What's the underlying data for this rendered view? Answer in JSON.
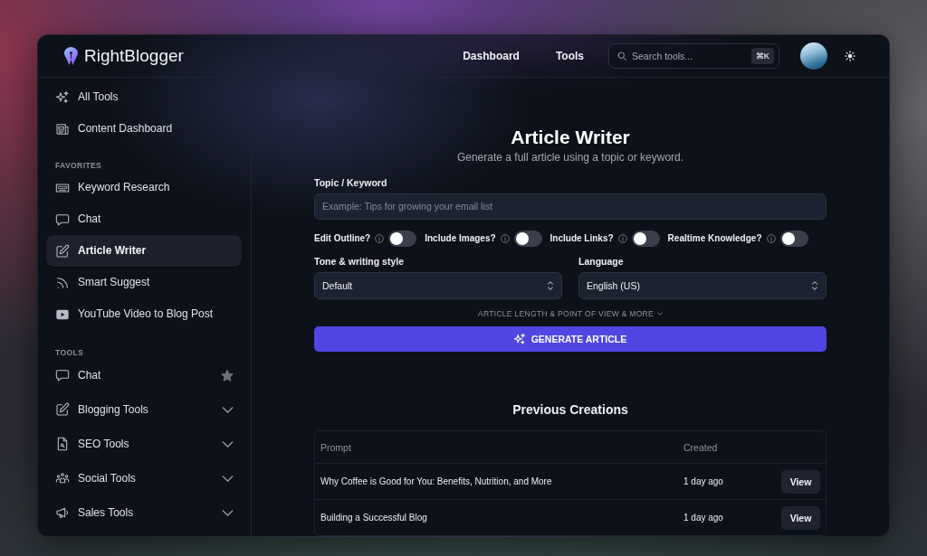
{
  "header": {
    "brand": "RightBlogger",
    "nav": [
      {
        "label": "Dashboard"
      },
      {
        "label": "Tools"
      }
    ],
    "search": {
      "placeholder": "Search tools...",
      "shortcut": "⌘K"
    }
  },
  "sidebar": {
    "groups": [
      {
        "items": [
          {
            "label": "All Tools",
            "kind": "link",
            "selected": false
          },
          {
            "label": "Content Dashboard",
            "kind": "link",
            "selected": false
          }
        ]
      },
      {
        "heading": "FAVORITES",
        "items": [
          {
            "label": "Keyword Research",
            "kind": "link",
            "selected": false
          },
          {
            "label": "Chat",
            "kind": "link",
            "selected": false
          },
          {
            "label": "Article Writer",
            "kind": "link",
            "selected": true
          },
          {
            "label": "Smart Suggest",
            "kind": "link",
            "selected": false
          },
          {
            "label": "YouTube Video to Blog Post",
            "kind": "link",
            "selected": false
          }
        ]
      },
      {
        "heading": "TOOLS",
        "items": [
          {
            "label": "Chat",
            "kind": "tool",
            "selected": false,
            "starred": true
          },
          {
            "label": "Blogging Tools",
            "kind": "category",
            "selected": false,
            "expanded": false
          },
          {
            "label": "SEO Tools",
            "kind": "category",
            "selected": false,
            "expanded": false
          },
          {
            "label": "Social Tools",
            "kind": "category",
            "selected": false,
            "expanded": false
          },
          {
            "label": "Sales Tools",
            "kind": "category",
            "selected": false,
            "expanded": false
          }
        ]
      }
    ]
  },
  "form": {
    "title": "Article Writer",
    "subtitle": "Generate a full article using a topic or keyword.",
    "topic": {
      "label": "Topic / Keyword",
      "placeholder": "Example: Tips for growing your email list"
    },
    "options": [
      {
        "label": "Edit Outline?",
        "on": false
      },
      {
        "label": "Include Images?",
        "on": false
      },
      {
        "label": "Include Links?",
        "on": false
      },
      {
        "label": "Realtime Knowledge?",
        "on": false
      }
    ],
    "tone": {
      "label": "Tone & writing style",
      "value": "Default"
    },
    "language": {
      "label": "Language",
      "value": "English (US)"
    },
    "more_options": {
      "label": "ARTICLE LENGTH & POINT OF VIEW & MORE",
      "expanded": false
    },
    "generate_button": "GENERATE ARTICLE"
  },
  "previous": {
    "title": "Previous Creations",
    "table": {
      "columns": [
        "Prompt",
        "Created"
      ],
      "rows": [
        {
          "prompt": "Why Coffee is Good for You: Benefits, Nutrition, and More",
          "created": "1 day ago",
          "action": "View"
        },
        {
          "prompt": "Building a Successful Blog",
          "created": "1 day ago",
          "action": "View"
        }
      ]
    }
  }
}
